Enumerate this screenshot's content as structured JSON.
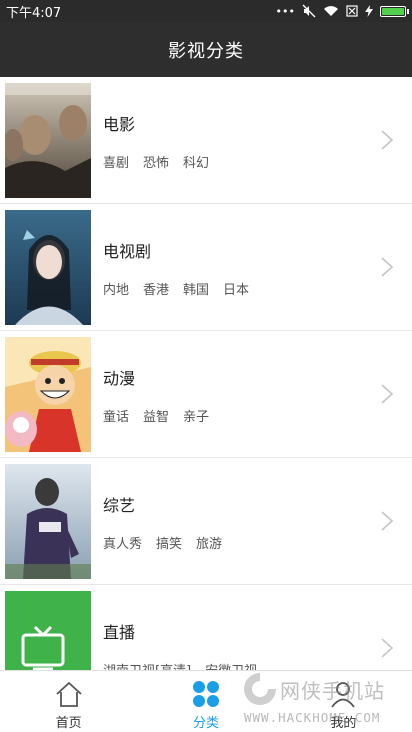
{
  "status": {
    "time": "下午4:07",
    "dots": "•••"
  },
  "header": {
    "title": "影视分类"
  },
  "categories": [
    {
      "name": "电影",
      "tags": [
        "喜剧",
        "恐怖",
        "科幻"
      ]
    },
    {
      "name": "电视剧",
      "tags": [
        "内地",
        "香港",
        "韩国",
        "日本"
      ]
    },
    {
      "name": "动漫",
      "tags": [
        "童话",
        "益智",
        "亲子"
      ]
    },
    {
      "name": "综艺",
      "tags": [
        "真人秀",
        "搞笑",
        "旅游"
      ]
    },
    {
      "name": "直播",
      "tags": [
        "湖南卫视[高清]",
        "安徽卫视"
      ]
    }
  ],
  "tabs": [
    {
      "label": "首页",
      "icon": "home-icon"
    },
    {
      "label": "分类",
      "icon": "category-grid-icon"
    },
    {
      "label": "我的",
      "icon": "user-icon"
    }
  ],
  "watermark": {
    "brand": "网侠手机站",
    "url": "WWW.HACKHOME.COM"
  },
  "colors": {
    "accent": "#1a9ee8",
    "header_bg": "#2e2e2e",
    "live_green": "#3fb24a"
  }
}
